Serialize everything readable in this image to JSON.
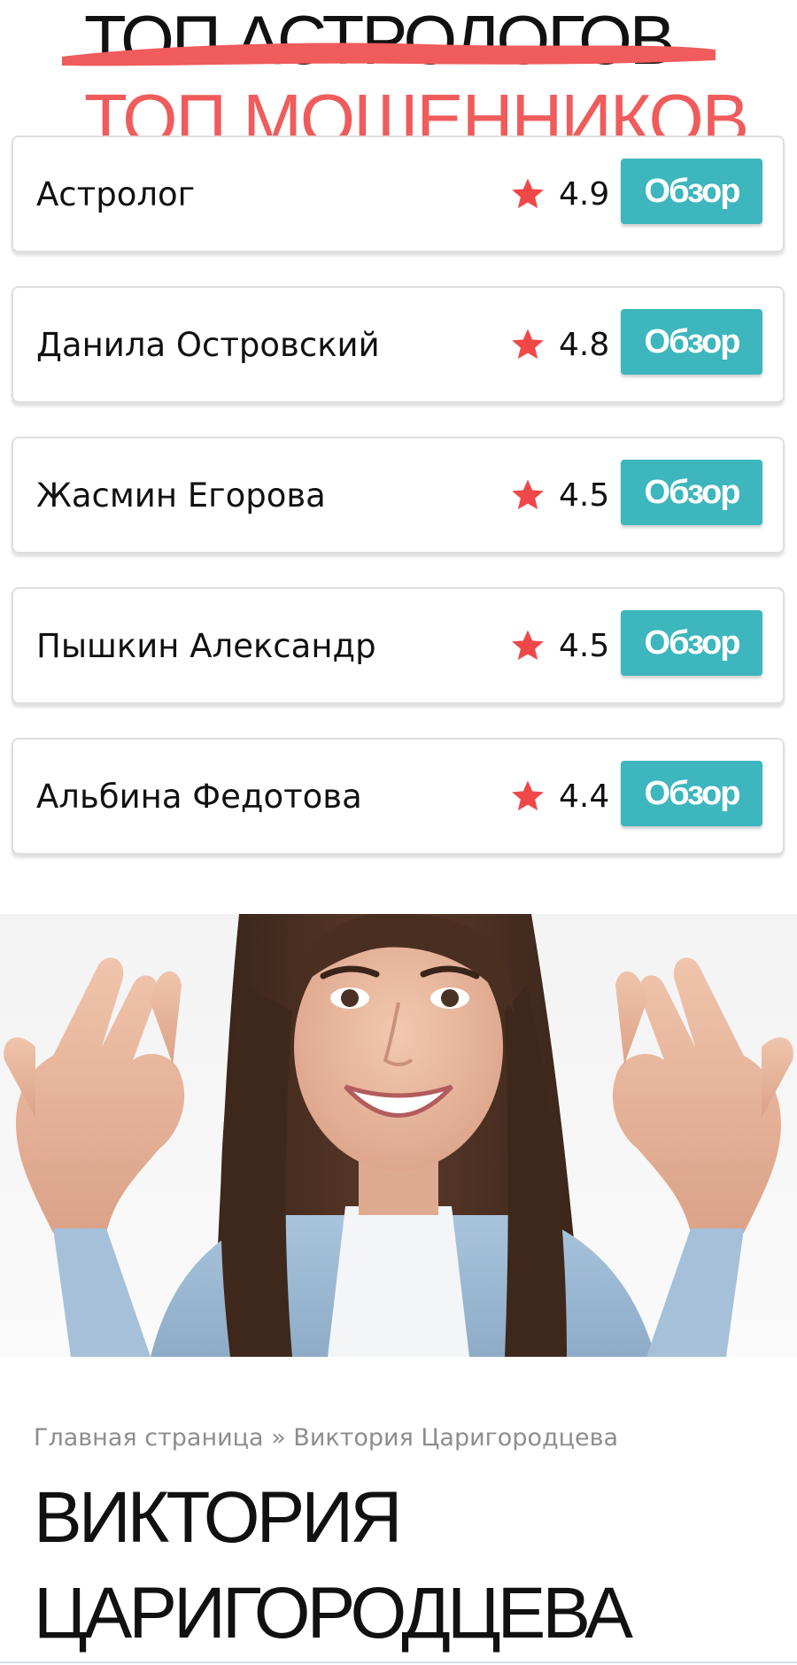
{
  "header": {
    "crossed_title": "ТОП АСТРОЛОГОВ",
    "overlay_title": "ТОП МОШЕННИКОВ",
    "strike_color": "#f05b5b"
  },
  "astrologers": [
    {
      "name": "Астролог",
      "rating": "4.9",
      "button": "Обзор",
      "icon": "star-icon"
    },
    {
      "name": "Данила Островский",
      "rating": "4.8",
      "button": "Обзор",
      "icon": "star-icon"
    },
    {
      "name": "Жасмин Егорова",
      "rating": "4.5",
      "button": "Обзор",
      "icon": "star-icon"
    },
    {
      "name": "Пышкин Александр",
      "rating": "4.5",
      "button": "Обзор",
      "icon": "star-icon"
    },
    {
      "name": "Альбина Федотова",
      "rating": "4.4",
      "button": "Обзор",
      "icon": "star-icon"
    }
  ],
  "colors": {
    "accent_button": "#3db6bd",
    "star": "#f04848",
    "breadcrumb": "#8d8d8d"
  },
  "breadcrumb": {
    "home": "Главная страница",
    "separator": "»",
    "current": "Виктория Царигородцева"
  },
  "title": {
    "line1": "ВИКТОРИЯ",
    "line2": "ЦАРИГОРОДЦЕВА"
  }
}
